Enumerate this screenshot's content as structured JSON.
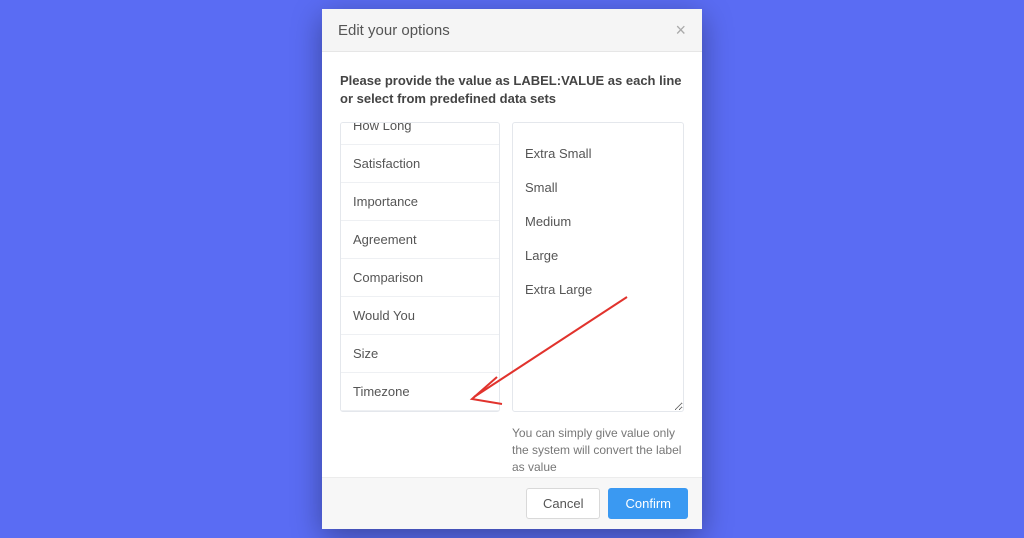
{
  "modal": {
    "title": "Edit your options",
    "instruction": "Please provide the value as LABEL:VALUE as each line or select from predefined data sets",
    "hint": "You can simply give value only the system will convert the label as value",
    "cancel_label": "Cancel",
    "confirm_label": "Confirm"
  },
  "presets": [
    "How Long",
    "Satisfaction",
    "Importance",
    "Agreement",
    "Comparison",
    "Would You",
    "Size",
    "Timezone"
  ],
  "values_text": "Extra Small\n\nSmall\n\nMedium\n\nLarge\n\nExtra Large"
}
